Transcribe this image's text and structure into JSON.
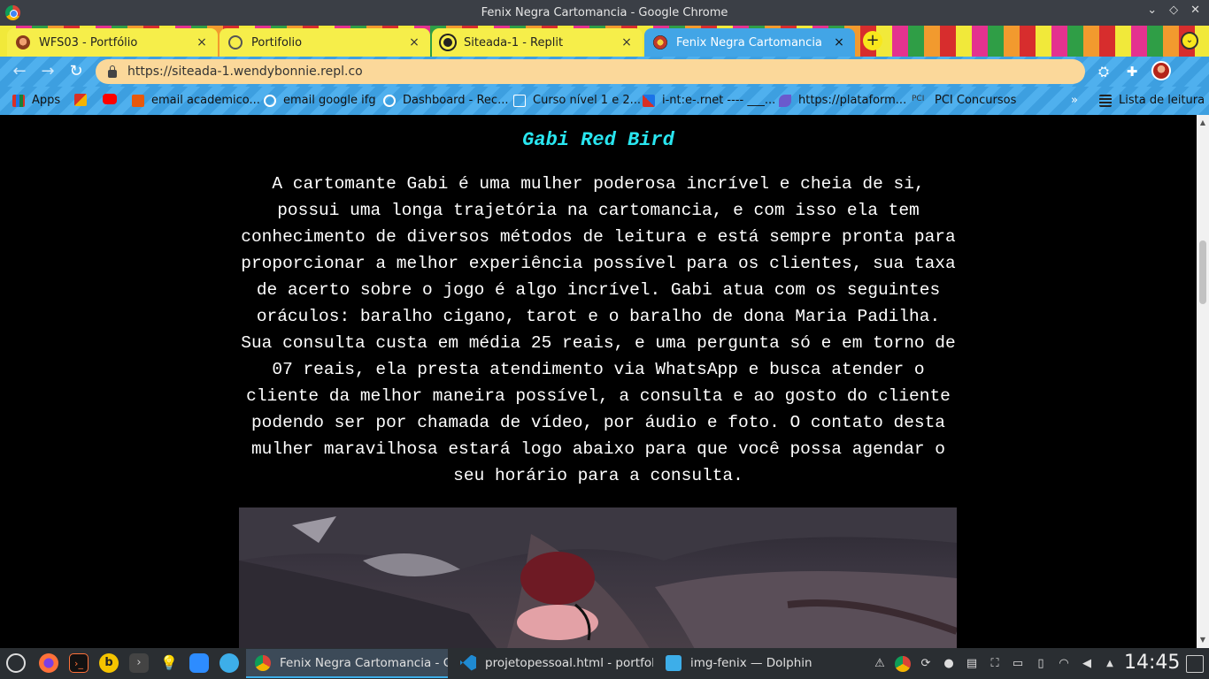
{
  "window": {
    "title": "Fenix Negra Cartomancia - Google Chrome",
    "controls": [
      "⌄",
      "◇",
      "✕"
    ]
  },
  "tabs": [
    {
      "title": "WFS03 - Portfólio",
      "active": false
    },
    {
      "title": "Portifolio",
      "active": false
    },
    {
      "title": "Siteada-1 - Replit",
      "active": false
    },
    {
      "title": "Fenix Negra Cartomancia",
      "active": true
    }
  ],
  "tab_close_glyph": "×",
  "new_tab_glyph": "+",
  "toolbar": {
    "back": "←",
    "forward": "→",
    "reload": "↻",
    "url": "https://siteada-1.wendybonnie.repl.co",
    "ext1": "⛭",
    "ext2": "✚"
  },
  "bookmarks": [
    {
      "label": "Apps"
    },
    {
      "label": ""
    },
    {
      "label": ""
    },
    {
      "label": "email academico..."
    },
    {
      "label": "email google ifg"
    },
    {
      "label": "Dashboard - Rec..."
    },
    {
      "label": "Curso nível 1 e 2..."
    },
    {
      "label": "i-nt:e-.rnet ---- ___..."
    },
    {
      "label": "https://plataform..."
    },
    {
      "label": "PCI Concursos"
    }
  ],
  "bookmarks_overflow": "»",
  "reading_list": "Lista de leitura",
  "page": {
    "title": "Gabi Red Bird",
    "bio": "A cartomante Gabi é uma mulher poderosa incrível e cheia de si, possui uma longa trajetória na cartomancia, e com isso ela tem conhecimento de diversos métodos de leitura e está sempre pronta para proporcionar a melhor experiência possível para os clientes, sua taxa de acerto sobre o jogo é algo incrível. Gabi atua com os seguintes oráculos: baralho cigano, tarot e o baralho de dona Maria Padilha. Sua consulta custa em média 25 reais, e uma pergunta só e em torno de 07 reais, ela presta atendimento via WhatsApp e busca atender o cliente da melhor maneira possível, a consulta e ao gosto do cliente podendo ser por chamada de vídeo, por áudio e foto. O contato desta mulher maravilhosa estará logo abaixo para que você possa agendar o seu horário para a consulta."
  },
  "scrollbar": {
    "up": "▲",
    "down": "▼"
  },
  "taskbar": {
    "tasks": [
      {
        "label": "Fenix Negra Cartomancia - Go...",
        "active": true
      },
      {
        "label": "projetopessoal.html - portfoli...",
        "active": false
      },
      {
        "label": "img-fenix — Dolphin",
        "active": false
      }
    ],
    "clock": "14:45",
    "tray_expand": "▲"
  },
  "colors": {
    "page_bg": "#000000",
    "title_color": "#29e6f0",
    "active_tab": "#42a5e6",
    "omnibox": "#fbd89a",
    "taskbar": "#2a2e32"
  }
}
